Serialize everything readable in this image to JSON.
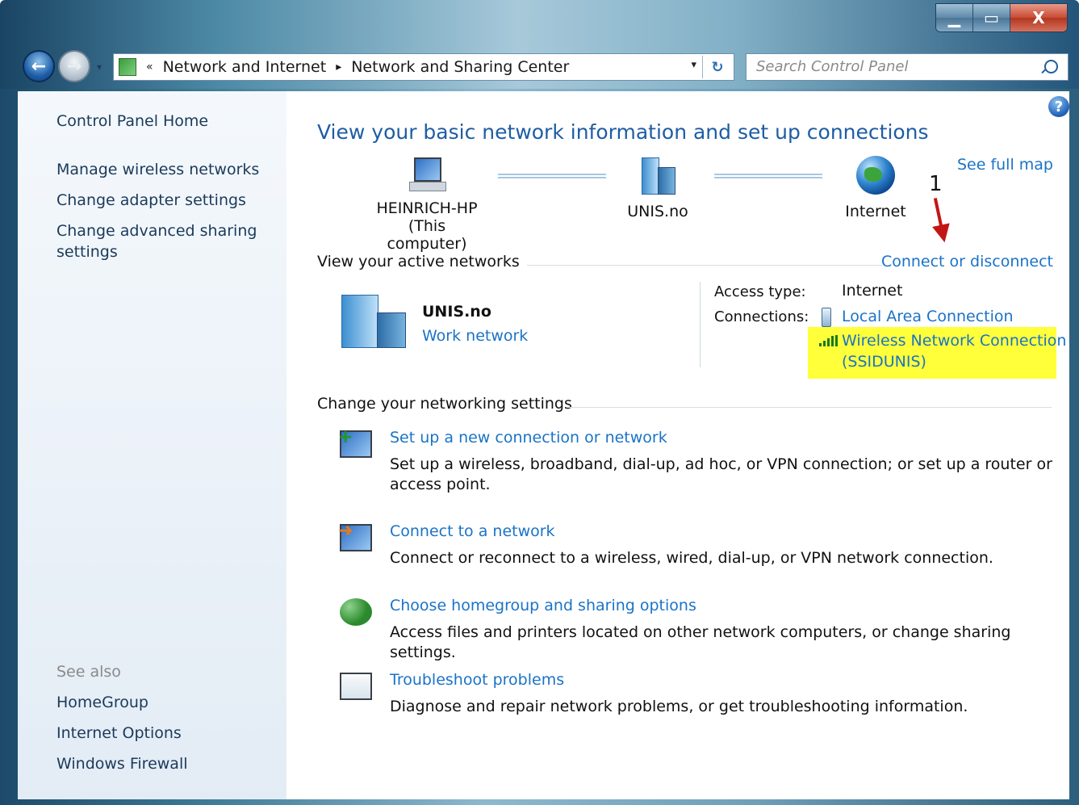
{
  "window": {
    "min_glyph": "▁",
    "max_glyph": "▭",
    "close_glyph": "X"
  },
  "addressbar": {
    "back_glyph": "←",
    "forward_glyph": "→",
    "dropdown_glyph": "▾",
    "overflow_glyph": "«",
    "crumbs": [
      "Network and Internet",
      "Network and Sharing Center"
    ],
    "separator": "▸",
    "refresh_glyph": "↻",
    "address_dropdown": "▾"
  },
  "search": {
    "placeholder": "Search Control Panel"
  },
  "sidebar": {
    "home": "Control Panel Home",
    "links": [
      "Manage wireless networks",
      "Change adapter settings",
      "Change advanced sharing",
      "settings"
    ],
    "see_also_title": "See also",
    "see_also": [
      "HomeGroup",
      "Internet Options",
      "Windows Firewall"
    ]
  },
  "main": {
    "help_glyph": "?",
    "title": "View your basic network information and set up connections",
    "see_full_map": "See full map",
    "map": {
      "computer_name": "HEINRICH-HP",
      "computer_sub": "(This computer)",
      "network": "UNIS.no",
      "internet": "Internet"
    },
    "annotation_number": "1",
    "active_header": "View your active networks",
    "connect_disconnect": "Connect or disconnect",
    "active": {
      "name": "UNIS.no",
      "type": "Work network",
      "access_label": "Access type:",
      "access_value": "Internet",
      "connections_label": "Connections:",
      "lan": "Local Area Connection",
      "wifi_line1": "Wireless Network Connection",
      "wifi_line2": "(SSIDUNIS)"
    },
    "change_header": "Change your networking settings",
    "tasks": [
      {
        "title": "Set up a new connection or network",
        "desc": "Set up a wireless, broadband, dial-up, ad hoc, or VPN connection; or set up a router or access point."
      },
      {
        "title": "Connect to a network",
        "desc": "Connect or reconnect to a wireless, wired, dial-up, or VPN network connection."
      },
      {
        "title": "Choose homegroup and sharing options",
        "desc": "Access files and printers located on other network computers, or change sharing settings."
      },
      {
        "title": "Troubleshoot problems",
        "desc": "Diagnose and repair network problems, or get troubleshooting information."
      }
    ]
  },
  "colors": {
    "link": "#1a73c7",
    "title": "#1e5da4",
    "highlight": "#ffff3a",
    "arrow": "#c21616"
  }
}
